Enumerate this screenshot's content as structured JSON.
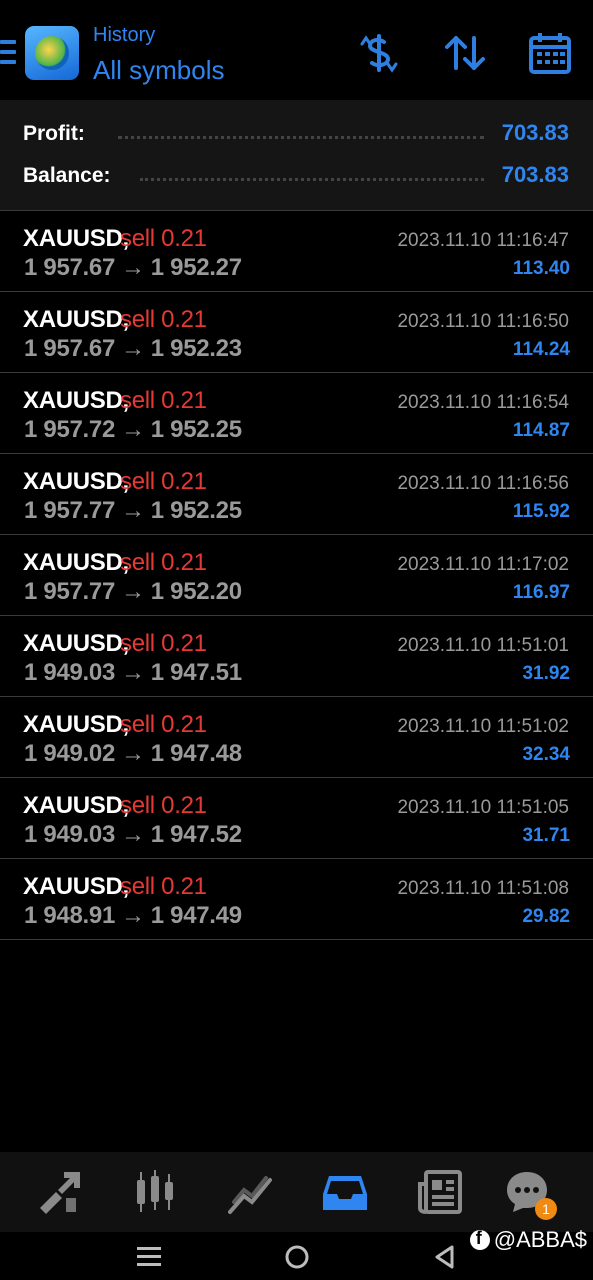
{
  "header": {
    "title": "History",
    "subtitle": "All symbols",
    "icons": [
      "menu-icon",
      "app-logo",
      "currency-exchange-icon",
      "sort-icon",
      "calendar-icon"
    ]
  },
  "summary": {
    "profit_label": "Profit:",
    "profit_value": "703.83",
    "balance_label": "Balance:",
    "balance_value": "703.83"
  },
  "deals": [
    {
      "symbol": "XAUUSD,",
      "side": "sell 0.21",
      "open_price": "1 957.67",
      "close_price": "1 952.27",
      "time": "2023.11.10 11:16:47",
      "profit": "113.40"
    },
    {
      "symbol": "XAUUSD,",
      "side": "sell 0.21",
      "open_price": "1 957.67",
      "close_price": "1 952.23",
      "time": "2023.11.10 11:16:50",
      "profit": "114.24"
    },
    {
      "symbol": "XAUUSD,",
      "side": "sell 0.21",
      "open_price": "1 957.72",
      "close_price": "1 952.25",
      "time": "2023.11.10 11:16:54",
      "profit": "114.87"
    },
    {
      "symbol": "XAUUSD,",
      "side": "sell 0.21",
      "open_price": "1 957.77",
      "close_price": "1 952.25",
      "time": "2023.11.10 11:16:56",
      "profit": "115.92"
    },
    {
      "symbol": "XAUUSD,",
      "side": "sell 0.21",
      "open_price": "1 957.77",
      "close_price": "1 952.20",
      "time": "2023.11.10 11:17:02",
      "profit": "116.97"
    },
    {
      "symbol": "XAUUSD,",
      "side": "sell 0.21",
      "open_price": "1 949.03",
      "close_price": "1 947.51",
      "time": "2023.11.10 11:51:01",
      "profit": "31.92"
    },
    {
      "symbol": "XAUUSD,",
      "side": "sell 0.21",
      "open_price": "1 949.02",
      "close_price": "1 947.48",
      "time": "2023.11.10 11:51:02",
      "profit": "32.34"
    },
    {
      "symbol": "XAUUSD,",
      "side": "sell 0.21",
      "open_price": "1 949.03",
      "close_price": "1 947.52",
      "time": "2023.11.10 11:51:05",
      "profit": "31.71"
    },
    {
      "symbol": "XAUUSD,",
      "side": "sell 0.21",
      "open_price": "1 948.91",
      "close_price": "1 947.49",
      "time": "2023.11.10 11:51:08",
      "profit": "29.82"
    }
  ],
  "deal_arrow": "→",
  "tabbar": {
    "tabs": [
      "trade-icon",
      "quotes-icon",
      "chart-icon",
      "history-icon",
      "news-icon",
      "chat-icon"
    ],
    "active": "history-icon",
    "chat_badge": "1"
  },
  "watermark": "@ABBA$",
  "colors": {
    "accent": "#2f86f0",
    "sell": "#e53935",
    "muted": "#9a9a9a",
    "badge": "#f08a12"
  }
}
